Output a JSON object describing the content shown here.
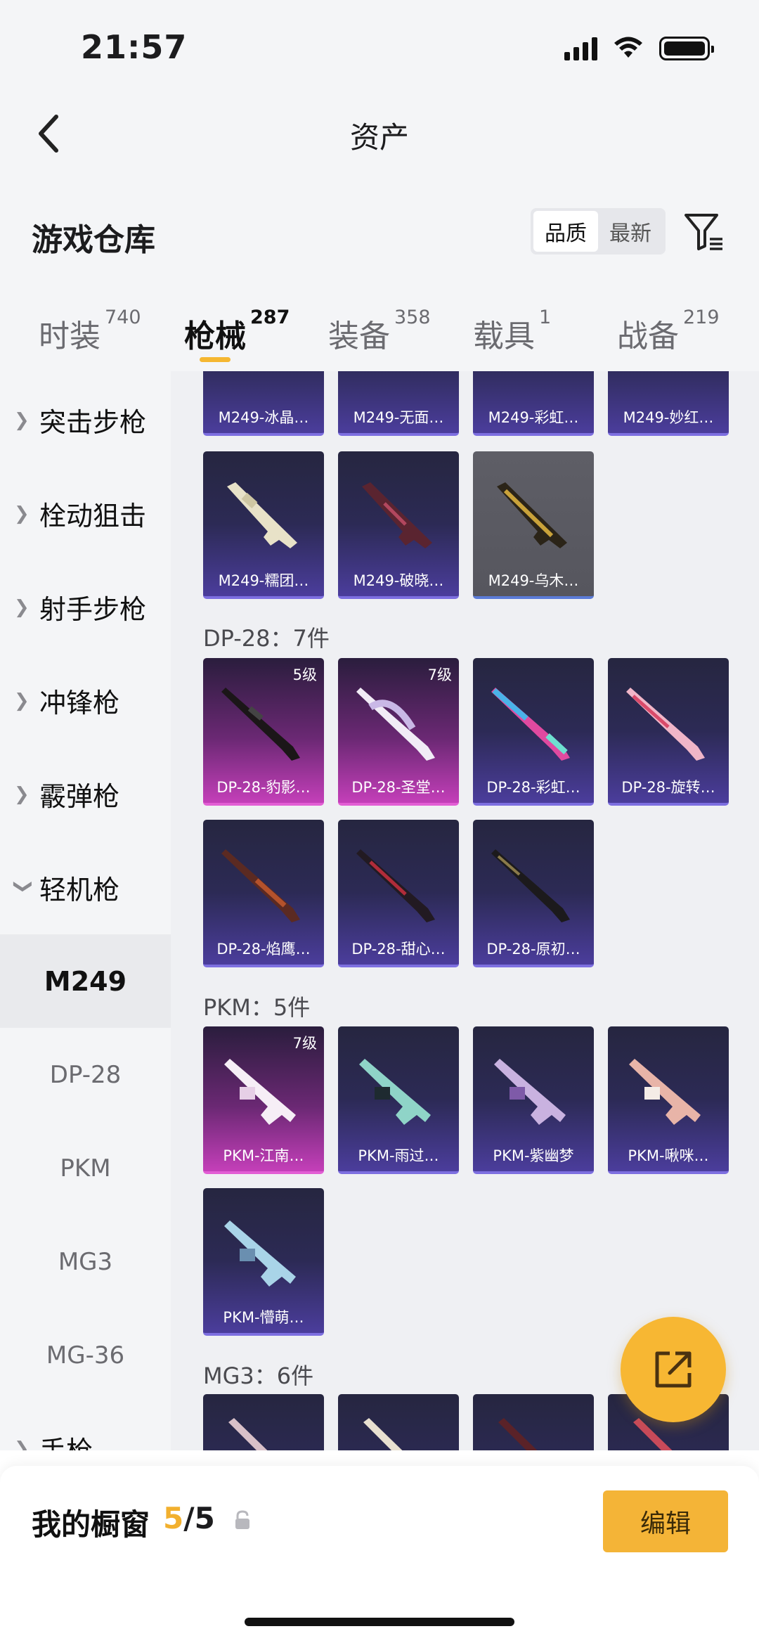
{
  "status_bar": {
    "time": "21:57"
  },
  "nav": {
    "title": "资产"
  },
  "warehouse": {
    "title": "游戏仓库",
    "sort_options": [
      "品质",
      "最新"
    ],
    "sort_active": "品质"
  },
  "tabs": [
    {
      "label": "时装",
      "count": "740"
    },
    {
      "label": "枪械",
      "count": "287"
    },
    {
      "label": "装备",
      "count": "358"
    },
    {
      "label": "载具",
      "count": "1"
    },
    {
      "label": "战备",
      "count": "219"
    }
  ],
  "sidebar": {
    "groups": [
      "突击步枪",
      "栓动狙击",
      "射手步枪",
      "冲锋枪",
      "霰弹枪",
      "轻机枪",
      "手枪"
    ],
    "sub_items": [
      "M249",
      "DP-28",
      "PKM",
      "MG3",
      "MG-36"
    ]
  },
  "sections": {
    "m249_top": [
      "M249-冰晶…",
      "M249-无面…",
      "M249-彩虹…",
      "M249-妙红…"
    ],
    "m249_row2": [
      "M249-糯团…",
      "M249-破晓…",
      "M249-乌木…"
    ],
    "dp28_title": "DP-28：7件",
    "dp28_row1": [
      "DP-28-豹影…",
      "DP-28-圣堂…",
      "DP-28-彩虹…",
      "DP-28-旋转…"
    ],
    "dp28_levels": [
      "5级",
      "7级"
    ],
    "dp28_row2": [
      "DP-28-焰鹰…",
      "DP-28-甜心…",
      "DP-28-原初…"
    ],
    "pkm_title": "PKM：5件",
    "pkm_row1": [
      "PKM-江南…",
      "PKM-雨过…",
      "PKM-紫幽梦",
      "PKM-啾咪…"
    ],
    "pkm_level": "7级",
    "pkm_row2": [
      "PKM-懵萌…"
    ],
    "mg3_title": "MG3：6件"
  },
  "bottom": {
    "window_label": "我的橱窗",
    "window_current": "5",
    "window_total": "/5",
    "edit_label": "编辑"
  },
  "icons": [
    "back-arrow-icon",
    "filter-icon",
    "chevron-right-icon",
    "chevron-down-icon",
    "share-icon",
    "lock-icon",
    "gun-icon"
  ],
  "colors": {
    "accent": "#f4b437",
    "card_purple": "#4b3d9c",
    "card_pink": "#c43fb9",
    "card_grey": "#5e5e66"
  }
}
